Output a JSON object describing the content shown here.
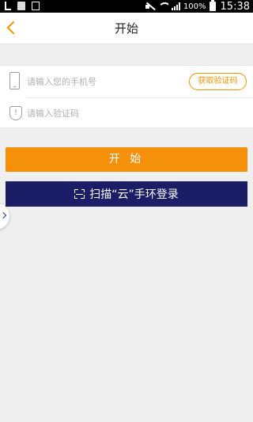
{
  "status_bar": {
    "battery_percent": "100%",
    "time": "15:38"
  },
  "header": {
    "title": "开始"
  },
  "form": {
    "phone_placeholder": "请输入您的手机号",
    "get_code_label": "获取验证码",
    "code_placeholder": "请输入验证码"
  },
  "actions": {
    "start_label": "开 始",
    "scan_label": "扫描“云”手环登录"
  },
  "icons": {
    "back": "chevron-left-icon",
    "phone": "phone-icon",
    "verify": "shield-icon",
    "scan": "scan-icon",
    "side": "chevron-right-icon"
  },
  "colors": {
    "accent_orange": "#f5900b",
    "navy": "#1b1e67",
    "background": "#efeff0"
  }
}
